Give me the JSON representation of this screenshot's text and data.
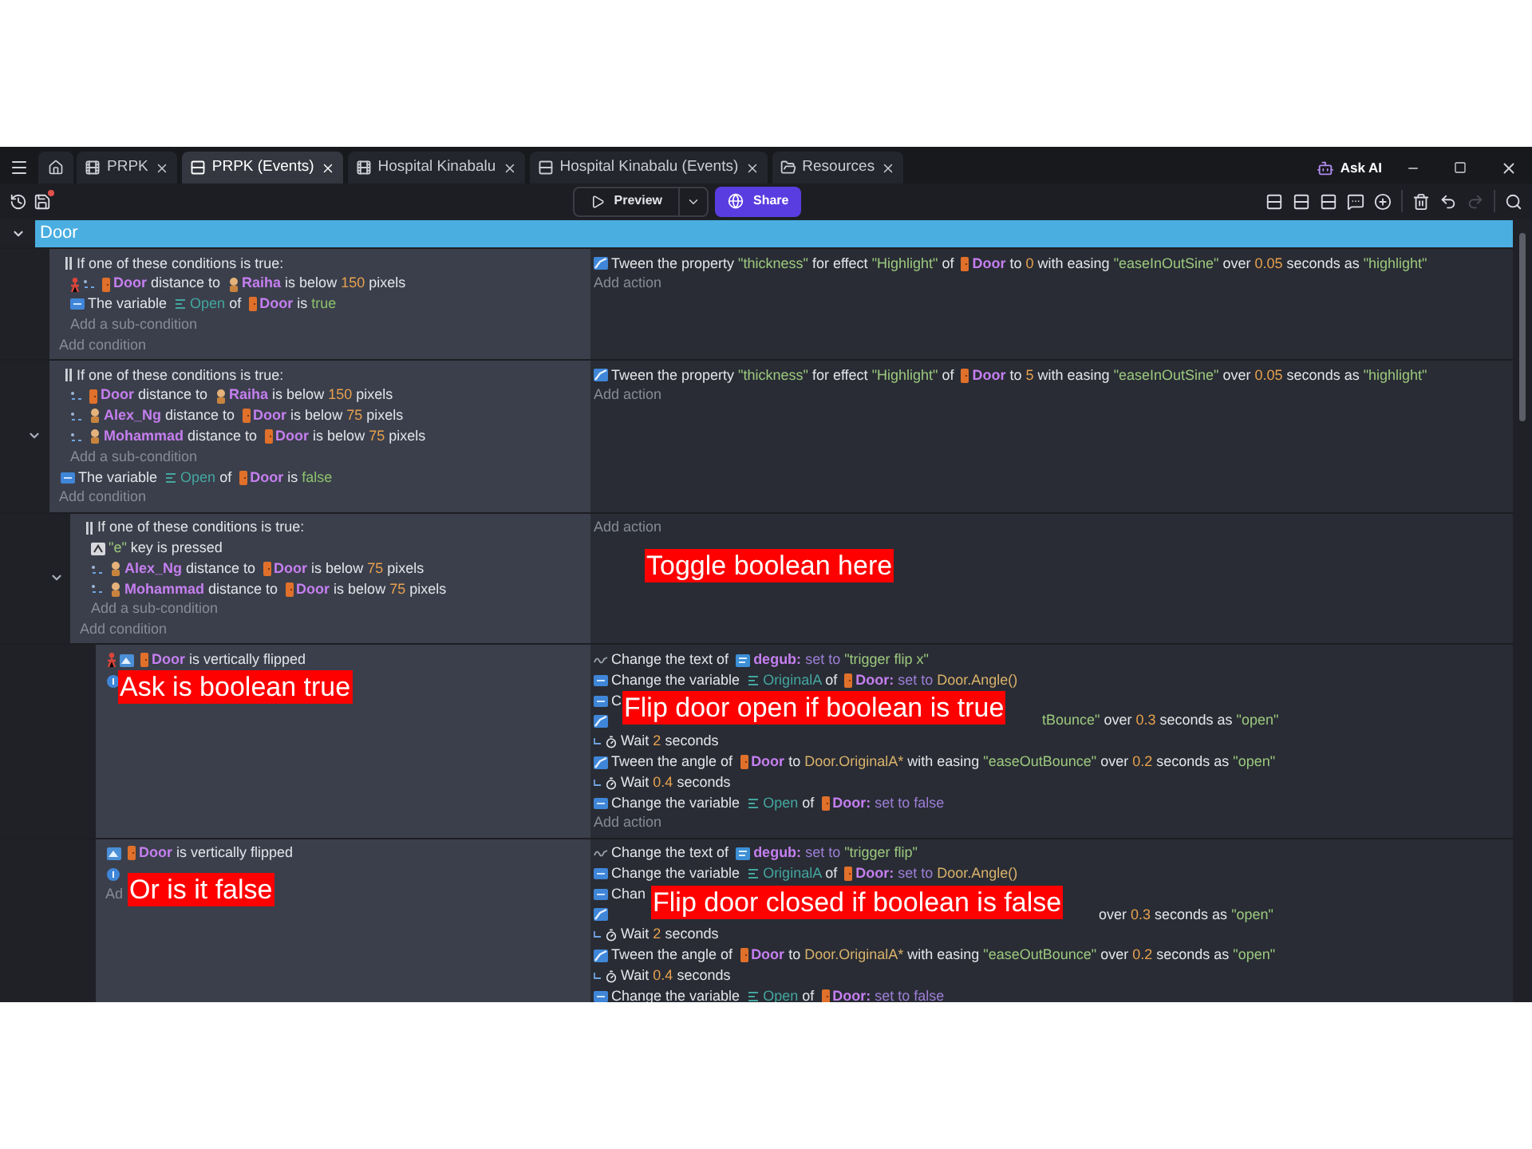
{
  "tabs": [
    {
      "label": "PRPK",
      "kind": "scene",
      "selected": false
    },
    {
      "label": "PRPK (Events)",
      "kind": "events",
      "selected": true
    },
    {
      "label": "Hospital Kinabalu",
      "kind": "scene",
      "selected": false
    },
    {
      "label": "Hospital Kinabalu (Events)",
      "kind": "events",
      "selected": false
    },
    {
      "label": "Resources",
      "kind": "resources",
      "selected": false
    }
  ],
  "ask_ai": "Ask AI",
  "toolbar": {
    "unsaved": true,
    "preview": "Preview",
    "share": "Share",
    "redo_disabled": true
  },
  "group": {
    "title": "Door",
    "expanded": true
  },
  "events": [
    {
      "conditions": [
        {
          "kind": "or",
          "title": "If one of these conditions is true:",
          "add_sub": "Add a sub-condition",
          "children": [
            {
              "kind": "distance",
              "inverted": true,
              "segments": [
                {
                  "kind": "door",
                  "text": "Door"
                },
                {
                  "kind": "plain",
                  "text": " distance to "
                },
                {
                  "kind": "character",
                  "text": "Raiha"
                },
                {
                  "kind": "plain",
                  "text": " is below "
                },
                {
                  "kind": "number",
                  "text": "150"
                },
                {
                  "kind": "plain",
                  "text": " pixels"
                }
              ]
            },
            {
              "kind": "variable",
              "inverted": false,
              "segments": [
                {
                  "kind": "plain",
                  "text": "The variable "
                },
                {
                  "kind": "variable",
                  "text": "Open"
                },
                {
                  "kind": "plain",
                  "text": " of "
                },
                {
                  "kind": "door",
                  "text": "Door"
                },
                {
                  "kind": "plain",
                  "text": " is "
                },
                {
                  "kind": "value",
                  "text": "true"
                }
              ]
            }
          ]
        }
      ],
      "add_condition": "Add condition",
      "actions": [
        {
          "kind": "tween",
          "segments": [
            {
              "kind": "plain",
              "text": "Tween the property "
            },
            {
              "kind": "string",
              "text": "\"thickness\""
            },
            {
              "kind": "plain",
              "text": " for effect "
            },
            {
              "kind": "string",
              "text": "\"Highlight\""
            },
            {
              "kind": "plain",
              "text": " of "
            },
            {
              "kind": "door",
              "text": "Door"
            },
            {
              "kind": "plain",
              "text": " to "
            },
            {
              "kind": "number",
              "text": "0"
            },
            {
              "kind": "plain",
              "text": " with easing "
            },
            {
              "kind": "string",
              "text": "\"easeInOutSine\""
            },
            {
              "kind": "plain",
              "text": " over "
            },
            {
              "kind": "number",
              "text": "0.05"
            },
            {
              "kind": "plain",
              "text": " seconds as "
            },
            {
              "kind": "string",
              "text": "\"highlight\""
            }
          ]
        }
      ],
      "add_action": "Add action"
    },
    {
      "expanded": true,
      "conditions": [
        {
          "kind": "or",
          "title": "If one of these conditions is true:",
          "add_sub": "Add a sub-condition",
          "children": [
            {
              "kind": "distance",
              "inverted": false,
              "segments": [
                {
                  "kind": "door",
                  "text": "Door"
                },
                {
                  "kind": "plain",
                  "text": " distance to "
                },
                {
                  "kind": "character",
                  "text": "Raiha"
                },
                {
                  "kind": "plain",
                  "text": " is below "
                },
                {
                  "kind": "number",
                  "text": "150"
                },
                {
                  "kind": "plain",
                  "text": " pixels"
                }
              ]
            },
            {
              "kind": "distance",
              "inverted": false,
              "segments": [
                {
                  "kind": "character",
                  "text": "Alex_Ng"
                },
                {
                  "kind": "plain",
                  "text": " distance to "
                },
                {
                  "kind": "door",
                  "text": "Door"
                },
                {
                  "kind": "plain",
                  "text": " is below "
                },
                {
                  "kind": "number",
                  "text": "75"
                },
                {
                  "kind": "plain",
                  "text": " pixels"
                }
              ]
            },
            {
              "kind": "distance",
              "inverted": false,
              "segments": [
                {
                  "kind": "character",
                  "text": "Mohammad"
                },
                {
                  "kind": "plain",
                  "text": " distance to "
                },
                {
                  "kind": "door",
                  "text": "Door"
                },
                {
                  "kind": "plain",
                  "text": " is below "
                },
                {
                  "kind": "number",
                  "text": "75"
                },
                {
                  "kind": "plain",
                  "text": " pixels"
                }
              ]
            }
          ]
        },
        {
          "kind": "variable",
          "inverted": false,
          "segments": [
            {
              "kind": "plain",
              "text": "The variable "
            },
            {
              "kind": "variable",
              "text": "Open"
            },
            {
              "kind": "plain",
              "text": " of "
            },
            {
              "kind": "door",
              "text": "Door"
            },
            {
              "kind": "plain",
              "text": " is "
            },
            {
              "kind": "value",
              "text": "false"
            }
          ]
        }
      ],
      "add_condition": "Add condition",
      "actions": [
        {
          "kind": "tween",
          "segments": [
            {
              "kind": "plain",
              "text": "Tween the property "
            },
            {
              "kind": "string",
              "text": "\"thickness\""
            },
            {
              "kind": "plain",
              "text": " for effect "
            },
            {
              "kind": "string",
              "text": "\"Highlight\""
            },
            {
              "kind": "plain",
              "text": " of "
            },
            {
              "kind": "door",
              "text": "Door"
            },
            {
              "kind": "plain",
              "text": " to "
            },
            {
              "kind": "number",
              "text": "5"
            },
            {
              "kind": "plain",
              "text": " with easing "
            },
            {
              "kind": "string",
              "text": "\"easeInOutSine\""
            },
            {
              "kind": "plain",
              "text": " over "
            },
            {
              "kind": "number",
              "text": "0.05"
            },
            {
              "kind": "plain",
              "text": " seconds as "
            },
            {
              "kind": "string",
              "text": "\"highlight\""
            }
          ]
        }
      ],
      "add_action": "Add action",
      "children": [
        {
          "expanded": true,
          "conditions": [
            {
              "kind": "or",
              "title": "If one of these conditions is true:",
              "add_sub": "Add a sub-condition",
              "children": [
                {
                  "kind": "key",
                  "inverted": false,
                  "segments": [
                    {
                      "kind": "string",
                      "text": "\"e\""
                    },
                    {
                      "kind": "plain",
                      "text": " key is pressed"
                    }
                  ]
                },
                {
                  "kind": "distance",
                  "inverted": false,
                  "segments": [
                    {
                      "kind": "character",
                      "text": "Alex_Ng"
                    },
                    {
                      "kind": "plain",
                      "text": " distance to "
                    },
                    {
                      "kind": "door",
                      "text": "Door"
                    },
                    {
                      "kind": "plain",
                      "text": " is below "
                    },
                    {
                      "kind": "number",
                      "text": "75"
                    },
                    {
                      "kind": "plain",
                      "text": " pixels"
                    }
                  ]
                },
                {
                  "kind": "distance",
                  "inverted": false,
                  "segments": [
                    {
                      "kind": "character",
                      "text": "Mohammad"
                    },
                    {
                      "kind": "plain",
                      "text": " distance to "
                    },
                    {
                      "kind": "door",
                      "text": "Door"
                    },
                    {
                      "kind": "plain",
                      "text": " is below "
                    },
                    {
                      "kind": "number",
                      "text": "75"
                    },
                    {
                      "kind": "plain",
                      "text": " pixels"
                    }
                  ]
                }
              ]
            }
          ],
          "add_condition": "Add condition",
          "add_action": "Add action",
          "action_note": "Toggle boolean here",
          "children": [
            {
              "conditions": [
                {
                  "kind": "flip",
                  "inverted": true,
                  "segments": [
                    {
                      "kind": "door",
                      "text": "Door"
                    },
                    {
                      "kind": "plain",
                      "text": " is vertically flipped"
                    }
                  ]
                },
                {
                  "kind": "trigger",
                  "inverted": false
                }
              ],
              "condition_note": "Ask is boolean true",
              "actions": [
                {
                  "kind": "text",
                  "segments": [
                    {
                      "kind": "plain",
                      "text": "Change the text of "
                    },
                    {
                      "kind": "textobject",
                      "text": "degub:"
                    },
                    {
                      "kind": "op",
                      "text": " set to "
                    },
                    {
                      "kind": "string",
                      "text": "\"trigger flip x\""
                    }
                  ]
                },
                {
                  "kind": "variable",
                  "segments": [
                    {
                      "kind": "plain",
                      "text": "Change the variable "
                    },
                    {
                      "kind": "variable",
                      "text": "OriginalA"
                    },
                    {
                      "kind": "plain",
                      "text": " of "
                    },
                    {
                      "kind": "door",
                      "text": "Door:"
                    },
                    {
                      "kind": "op",
                      "text": " set to "
                    },
                    {
                      "kind": "expression",
                      "text": "Door.Angle()"
                    }
                  ]
                },
                {
                  "kind": "variable",
                  "segments": [
                    {
                      "kind": "plain",
                      "text": "C"
                    }
                  ]
                },
                {
                  "kind": "tween",
                  "segments": [
                    {
                      "kind": "covered"
                    },
                    {
                      "kind": "string",
                      "text": "tBounce\""
                    },
                    {
                      "kind": "plain",
                      "text": " over "
                    },
                    {
                      "kind": "number",
                      "text": "0.3"
                    },
                    {
                      "kind": "plain",
                      "text": " seconds as "
                    },
                    {
                      "kind": "string",
                      "text": "\"open\""
                    }
                  ]
                },
                {
                  "kind": "wait",
                  "segments": [
                    {
                      "kind": "plain",
                      "text": "Wait "
                    },
                    {
                      "kind": "number",
                      "text": "2"
                    },
                    {
                      "kind": "plain",
                      "text": " seconds"
                    }
                  ]
                },
                {
                  "kind": "tween",
                  "segments": [
                    {
                      "kind": "plain",
                      "text": "Tween the angle of "
                    },
                    {
                      "kind": "door",
                      "text": "Door"
                    },
                    {
                      "kind": "plain",
                      "text": " to "
                    },
                    {
                      "kind": "expression",
                      "text": "Door.OriginalA*"
                    },
                    {
                      "kind": "plain",
                      "text": " with easing "
                    },
                    {
                      "kind": "string",
                      "text": "\"easeOutBounce\""
                    },
                    {
                      "kind": "plain",
                      "text": " over "
                    },
                    {
                      "kind": "number",
                      "text": "0.2"
                    },
                    {
                      "kind": "plain",
                      "text": " seconds as "
                    },
                    {
                      "kind": "string",
                      "text": "\"open\""
                    }
                  ]
                },
                {
                  "kind": "wait",
                  "segments": [
                    {
                      "kind": "plain",
                      "text": "Wait "
                    },
                    {
                      "kind": "number",
                      "text": "0.4"
                    },
                    {
                      "kind": "plain",
                      "text": " seconds"
                    }
                  ]
                },
                {
                  "kind": "variable",
                  "segments": [
                    {
                      "kind": "plain",
                      "text": "Change the variable "
                    },
                    {
                      "kind": "variable",
                      "text": "Open"
                    },
                    {
                      "kind": "plain",
                      "text": " of "
                    },
                    {
                      "kind": "door",
                      "text": "Door:"
                    },
                    {
                      "kind": "op",
                      "text": " set to false"
                    }
                  ]
                }
              ],
              "add_action": "Add action",
              "action_note": "Flip door open if boolean is true"
            },
            {
              "conditions": [
                {
                  "kind": "flip",
                  "inverted": false,
                  "segments": [
                    {
                      "kind": "door",
                      "text": "Door"
                    },
                    {
                      "kind": "plain",
                      "text": " is vertically flipped"
                    }
                  ]
                },
                {
                  "kind": "trigger",
                  "inverted": false
                }
              ],
              "add_condition": "Ad",
              "condition_note": "Or is it false",
              "actions": [
                {
                  "kind": "text",
                  "segments": [
                    {
                      "kind": "plain",
                      "text": "Change the text of "
                    },
                    {
                      "kind": "textobject",
                      "text": "degub:"
                    },
                    {
                      "kind": "op",
                      "text": " set to "
                    },
                    {
                      "kind": "string",
                      "text": "\"trigger flip\""
                    }
                  ]
                },
                {
                  "kind": "variable",
                  "segments": [
                    {
                      "kind": "plain",
                      "text": "Change the variable "
                    },
                    {
                      "kind": "variable",
                      "text": "OriginalA"
                    },
                    {
                      "kind": "plain",
                      "text": " of "
                    },
                    {
                      "kind": "door",
                      "text": "Door:"
                    },
                    {
                      "kind": "op",
                      "text": " set to "
                    },
                    {
                      "kind": "expression",
                      "text": "Door.Angle()"
                    }
                  ]
                },
                {
                  "kind": "variable",
                  "segments": [
                    {
                      "kind": "plain",
                      "text": "Chan"
                    }
                  ]
                },
                {
                  "kind": "tween",
                  "segments": [
                    {
                      "kind": "covered"
                    },
                    {
                      "kind": "plain",
                      "text": " over "
                    },
                    {
                      "kind": "number",
                      "text": "0.3"
                    },
                    {
                      "kind": "plain",
                      "text": " seconds as "
                    },
                    {
                      "kind": "string",
                      "text": "\"open\""
                    }
                  ]
                },
                {
                  "kind": "wait",
                  "segments": [
                    {
                      "kind": "plain",
                      "text": "Wait "
                    },
                    {
                      "kind": "number",
                      "text": "2"
                    },
                    {
                      "kind": "plain",
                      "text": " seconds"
                    }
                  ]
                },
                {
                  "kind": "tween",
                  "segments": [
                    {
                      "kind": "plain",
                      "text": "Tween the angle of "
                    },
                    {
                      "kind": "door",
                      "text": "Door"
                    },
                    {
                      "kind": "plain",
                      "text": " to "
                    },
                    {
                      "kind": "expression",
                      "text": "Door.OriginalA*"
                    },
                    {
                      "kind": "plain",
                      "text": " with easing "
                    },
                    {
                      "kind": "string",
                      "text": "\"easeOutBounce\""
                    },
                    {
                      "kind": "plain",
                      "text": " over "
                    },
                    {
                      "kind": "number",
                      "text": "0.2"
                    },
                    {
                      "kind": "plain",
                      "text": " seconds as "
                    },
                    {
                      "kind": "string",
                      "text": "\"open\""
                    }
                  ]
                },
                {
                  "kind": "wait",
                  "segments": [
                    {
                      "kind": "plain",
                      "text": "Wait "
                    },
                    {
                      "kind": "number",
                      "text": "0.4"
                    },
                    {
                      "kind": "plain",
                      "text": " seconds"
                    }
                  ]
                },
                {
                  "kind": "variable",
                  "segments": [
                    {
                      "kind": "plain",
                      "text": "Change the variable "
                    },
                    {
                      "kind": "variable",
                      "text": "Open"
                    },
                    {
                      "kind": "plain",
                      "text": " of "
                    },
                    {
                      "kind": "door",
                      "text": "Door:"
                    },
                    {
                      "kind": "op",
                      "text": " set to false"
                    }
                  ]
                }
              ],
              "action_note": "Flip door closed if boolean is false"
            }
          ]
        }
      ]
    }
  ]
}
